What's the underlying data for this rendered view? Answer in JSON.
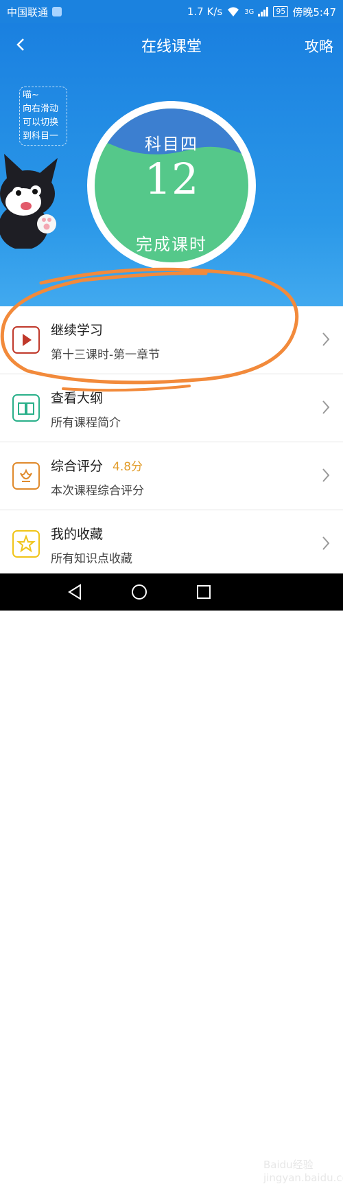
{
  "statusbar": {
    "carrier": "中国联通",
    "speed": "1.7 K/s",
    "battery": "95",
    "time": "傍晚5:47",
    "signal_label": "3G"
  },
  "header": {
    "back_icon": "chevron-left-icon",
    "title": "在线课堂",
    "strategy": "攻略"
  },
  "tip": {
    "lines": [
      "喵~",
      "向右滑动",
      "可以切换",
      "到科目一"
    ]
  },
  "progress": {
    "subject": "科目四",
    "count": "12",
    "label": "完成课时"
  },
  "items": [
    {
      "icon": "play-icon",
      "title": "继续学习",
      "subtitle": "第十三课时-第一章节",
      "extra": ""
    },
    {
      "icon": "book-icon",
      "title": "查看大纲",
      "subtitle": "所有课程简介",
      "extra": ""
    },
    {
      "icon": "flower-icon",
      "title": "综合评分",
      "subtitle": "本次课程综合评分",
      "extra": "4.8分"
    },
    {
      "icon": "star-icon",
      "title": "我的收藏",
      "subtitle": "所有知识点收藏",
      "extra": ""
    }
  ],
  "colors": {
    "hero": "#1b82df",
    "circle_green": "#55c88a",
    "circle_blue": "#3c7fd0",
    "play_red": "#c0392b",
    "book_teal": "#2ab08a",
    "flower_orange": "#e08a2c",
    "star_yellow": "#f0c419",
    "annotation_orange": "#f28a3b"
  },
  "watermark": "Baidu经验 jingyan.baidu.com"
}
